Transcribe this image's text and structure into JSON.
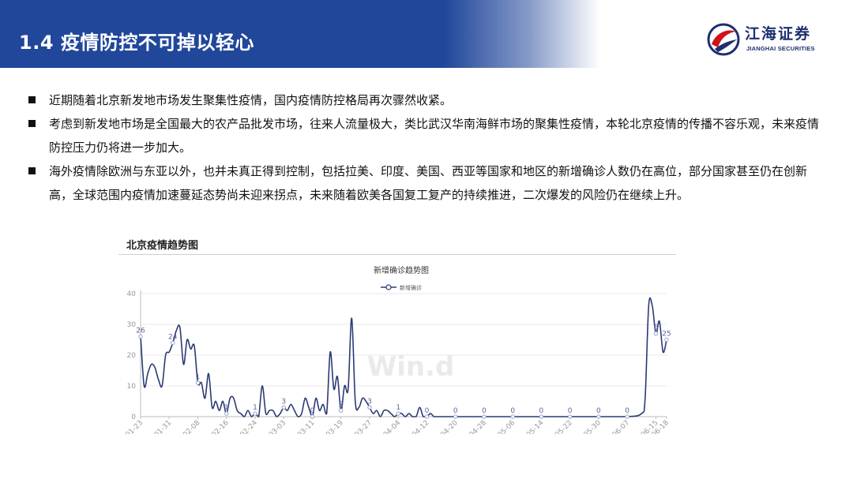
{
  "slide": {
    "title": "1.4 疫情防控不可掉以轻心",
    "brand_color": "#21479a"
  },
  "logo": {
    "name": "江海证券",
    "sub": "JIANGHAI SECURITIES",
    "icon": "jianghai-logo-icon"
  },
  "bullets": [
    "近期随着北京新发地市场发生聚集性疫情，国内疫情防控格局再次骤然收紧。",
    "考虑到新发地市场是全国最大的农产品批发市场，往来人流量极大，类比武汉华南海鲜市场的聚集性疫情，本轮北京疫情的传播不容乐观，未来疫情防控压力仍将进一步加大。",
    "海外疫情除欧洲与东亚以外，也并未真正得到控制，包括拉美、印度、美国、西亚等国家和地区的新增确诊人数仍在高位，部分国家甚至仍在创新高，全球范围内疫情加速蔓延态势尚未迎来拐点，未来随着欧美各国复工复产的持续推进，二次爆发的风险仍在继续上升。"
  ],
  "panel": {
    "title": "北京疫情趋势图",
    "watermark": "Win.d"
  },
  "chart_data": {
    "type": "line",
    "title": "新增确诊趋势图",
    "legend": "top-center",
    "grid": true,
    "ylim": [
      0,
      40
    ],
    "yticks": [
      0,
      10,
      20,
      30,
      40
    ],
    "xticks": [
      "01-23",
      "01-31",
      "02-08",
      "02-16",
      "02-24",
      "03-03",
      "03-11",
      "03-19",
      "03-27",
      "04-04",
      "04-12",
      "04-20",
      "04-28",
      "05-06",
      "05-14",
      "05-22",
      "05-30",
      "06-07",
      "06-15",
      "06-18"
    ],
    "line_color": "#2b3a75",
    "series": [
      {
        "name": "新增确诊",
        "points": [
          [
            "01-23",
            26
          ],
          [
            "01-24",
            10
          ],
          [
            "01-25",
            14
          ],
          [
            "01-26",
            17
          ],
          [
            "01-27",
            16
          ],
          [
            "01-28",
            12
          ],
          [
            "01-29",
            10
          ],
          [
            "01-30",
            20
          ],
          [
            "01-31",
            21
          ],
          [
            "02-01",
            24
          ],
          [
            "02-02",
            28
          ],
          [
            "02-03",
            29
          ],
          [
            "02-04",
            17
          ],
          [
            "02-05",
            25
          ],
          [
            "02-06",
            22
          ],
          [
            "02-07",
            23
          ],
          [
            "02-08",
            11
          ],
          [
            "02-09",
            11
          ],
          [
            "02-10",
            6
          ],
          [
            "02-11",
            14
          ],
          [
            "02-12",
            3
          ],
          [
            "02-13",
            5
          ],
          [
            "02-14",
            2
          ],
          [
            "02-15",
            5
          ],
          [
            "02-16",
            1
          ],
          [
            "02-17",
            6
          ],
          [
            "02-18",
            6
          ],
          [
            "02-19",
            2
          ],
          [
            "02-20",
            1
          ],
          [
            "02-21",
            0
          ],
          [
            "02-22",
            2
          ],
          [
            "02-23",
            0
          ],
          [
            "02-24",
            1
          ],
          [
            "02-25",
            0
          ],
          [
            "02-26",
            10
          ],
          [
            "02-27",
            1
          ],
          [
            "02-28",
            2
          ],
          [
            "02-29",
            2
          ],
          [
            "03-01",
            0
          ],
          [
            "03-02",
            1
          ],
          [
            "03-03",
            3
          ],
          [
            "03-04",
            2
          ],
          [
            "03-05",
            4
          ],
          [
            "03-06",
            2
          ],
          [
            "03-07",
            0
          ],
          [
            "03-08",
            1
          ],
          [
            "03-09",
            6
          ],
          [
            "03-10",
            3
          ],
          [
            "03-11",
            0
          ],
          [
            "03-12",
            6
          ],
          [
            "03-13",
            2
          ],
          [
            "03-14",
            4
          ],
          [
            "03-15",
            1
          ],
          [
            "03-16",
            21
          ],
          [
            "03-17",
            9
          ],
          [
            "03-18",
            13
          ],
          [
            "03-19",
            2
          ],
          [
            "03-20",
            10
          ],
          [
            "03-21",
            9
          ],
          [
            "03-22",
            32
          ],
          [
            "03-23",
            5
          ],
          [
            "03-24",
            3
          ],
          [
            "03-25",
            6
          ],
          [
            "03-26",
            5
          ],
          [
            "03-27",
            3
          ],
          [
            "03-28",
            1
          ],
          [
            "03-29",
            2
          ],
          [
            "03-30",
            0
          ],
          [
            "03-31",
            2
          ],
          [
            "04-01",
            2
          ],
          [
            "04-02",
            1
          ],
          [
            "04-03",
            0
          ],
          [
            "04-04",
            1
          ],
          [
            "04-05",
            1
          ],
          [
            "04-06",
            0
          ],
          [
            "04-07",
            1
          ],
          [
            "04-08",
            0
          ],
          [
            "04-09",
            0
          ],
          [
            "04-10",
            3
          ],
          [
            "04-11",
            0
          ],
          [
            "04-12",
            0
          ],
          [
            "04-13",
            1
          ],
          [
            "04-14",
            0
          ],
          [
            "04-15",
            0
          ],
          [
            "04-16",
            0
          ],
          [
            "04-20",
            0
          ],
          [
            "04-28",
            0
          ],
          [
            "05-06",
            0
          ],
          [
            "05-14",
            0
          ],
          [
            "05-22",
            0
          ],
          [
            "05-30",
            0
          ],
          [
            "06-07",
            0
          ],
          [
            "06-11",
            1
          ],
          [
            "06-12",
            6
          ],
          [
            "06-13",
            36
          ],
          [
            "06-14",
            36
          ],
          [
            "06-15",
            27
          ],
          [
            "06-16",
            31
          ],
          [
            "06-17",
            21
          ],
          [
            "06-18",
            25
          ]
        ]
      }
    ],
    "data_labels": [
      [
        "01-23",
        "26"
      ],
      [
        "02-01",
        "24"
      ],
      [
        "02-08",
        "1"
      ],
      [
        "02-16",
        "1"
      ],
      [
        "02-24",
        "1"
      ],
      [
        "03-03",
        "3"
      ],
      [
        "03-11",
        "0"
      ],
      [
        "03-19",
        "2"
      ],
      [
        "03-27",
        "3"
      ],
      [
        "04-04",
        "1"
      ],
      [
        "04-12",
        "0"
      ],
      [
        "04-20",
        "0"
      ],
      [
        "04-28",
        "0"
      ],
      [
        "05-06",
        "0"
      ],
      [
        "05-14",
        "0"
      ],
      [
        "05-22",
        "0"
      ],
      [
        "05-30",
        "0"
      ],
      [
        "06-07",
        "0"
      ],
      [
        "06-15",
        "6"
      ],
      [
        "06-18",
        "25"
      ]
    ]
  }
}
